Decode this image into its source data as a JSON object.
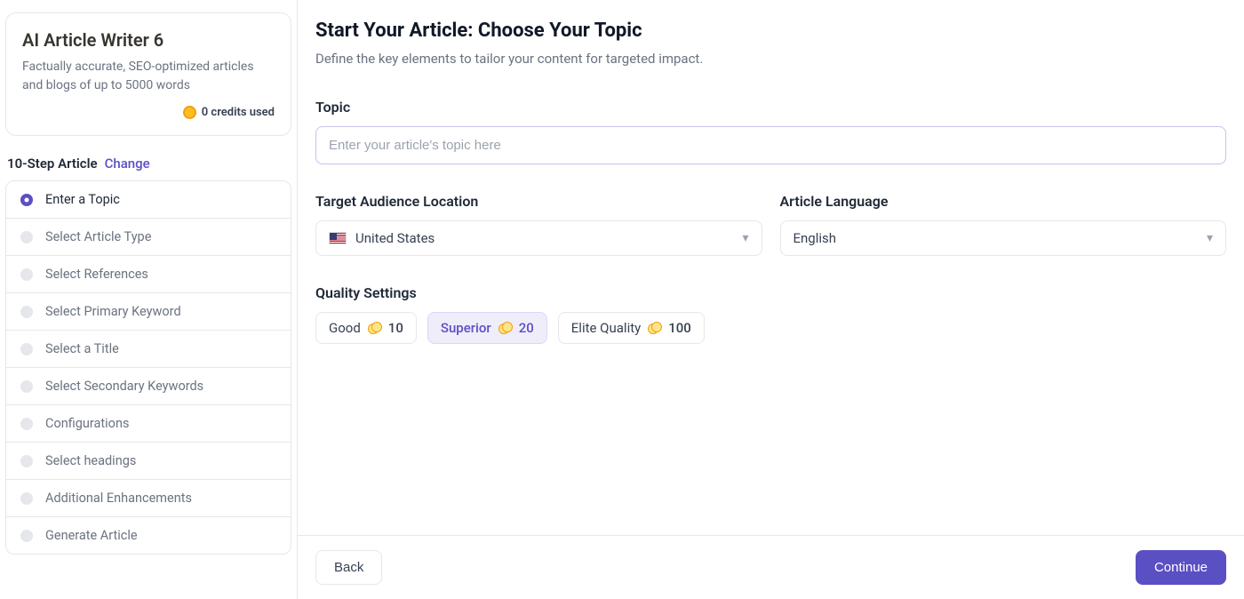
{
  "sidebar": {
    "title": "AI Article Writer 6",
    "description": "Factually accurate, SEO-optimized articles and blogs of up to 5000 words",
    "credits_used": "0 credits used",
    "steps_title": "10-Step Article",
    "change_label": "Change",
    "steps": [
      {
        "label": "Enter a Topic",
        "active": true
      },
      {
        "label": "Select Article Type",
        "active": false
      },
      {
        "label": "Select References",
        "active": false
      },
      {
        "label": "Select Primary Keyword",
        "active": false
      },
      {
        "label": "Select a Title",
        "active": false
      },
      {
        "label": "Select Secondary Keywords",
        "active": false
      },
      {
        "label": "Configurations",
        "active": false
      },
      {
        "label": "Select headings",
        "active": false
      },
      {
        "label": "Additional Enhancements",
        "active": false
      },
      {
        "label": "Generate Article",
        "active": false
      }
    ]
  },
  "main": {
    "title": "Start Your Article: Choose Your Topic",
    "subtitle": "Define the key elements to tailor your content for targeted impact.",
    "topic": {
      "label": "Topic",
      "placeholder": "Enter your article's topic here",
      "value": ""
    },
    "location": {
      "label": "Target Audience Location",
      "value": "United States"
    },
    "language": {
      "label": "Article Language",
      "value": "English"
    },
    "quality": {
      "label": "Quality Settings",
      "options": [
        {
          "name": "Good",
          "cost": "10",
          "selected": false
        },
        {
          "name": "Superior",
          "cost": "20",
          "selected": true
        },
        {
          "name": "Elite Quality",
          "cost": "100",
          "selected": false
        }
      ]
    }
  },
  "footer": {
    "back": "Back",
    "continue": "Continue"
  }
}
